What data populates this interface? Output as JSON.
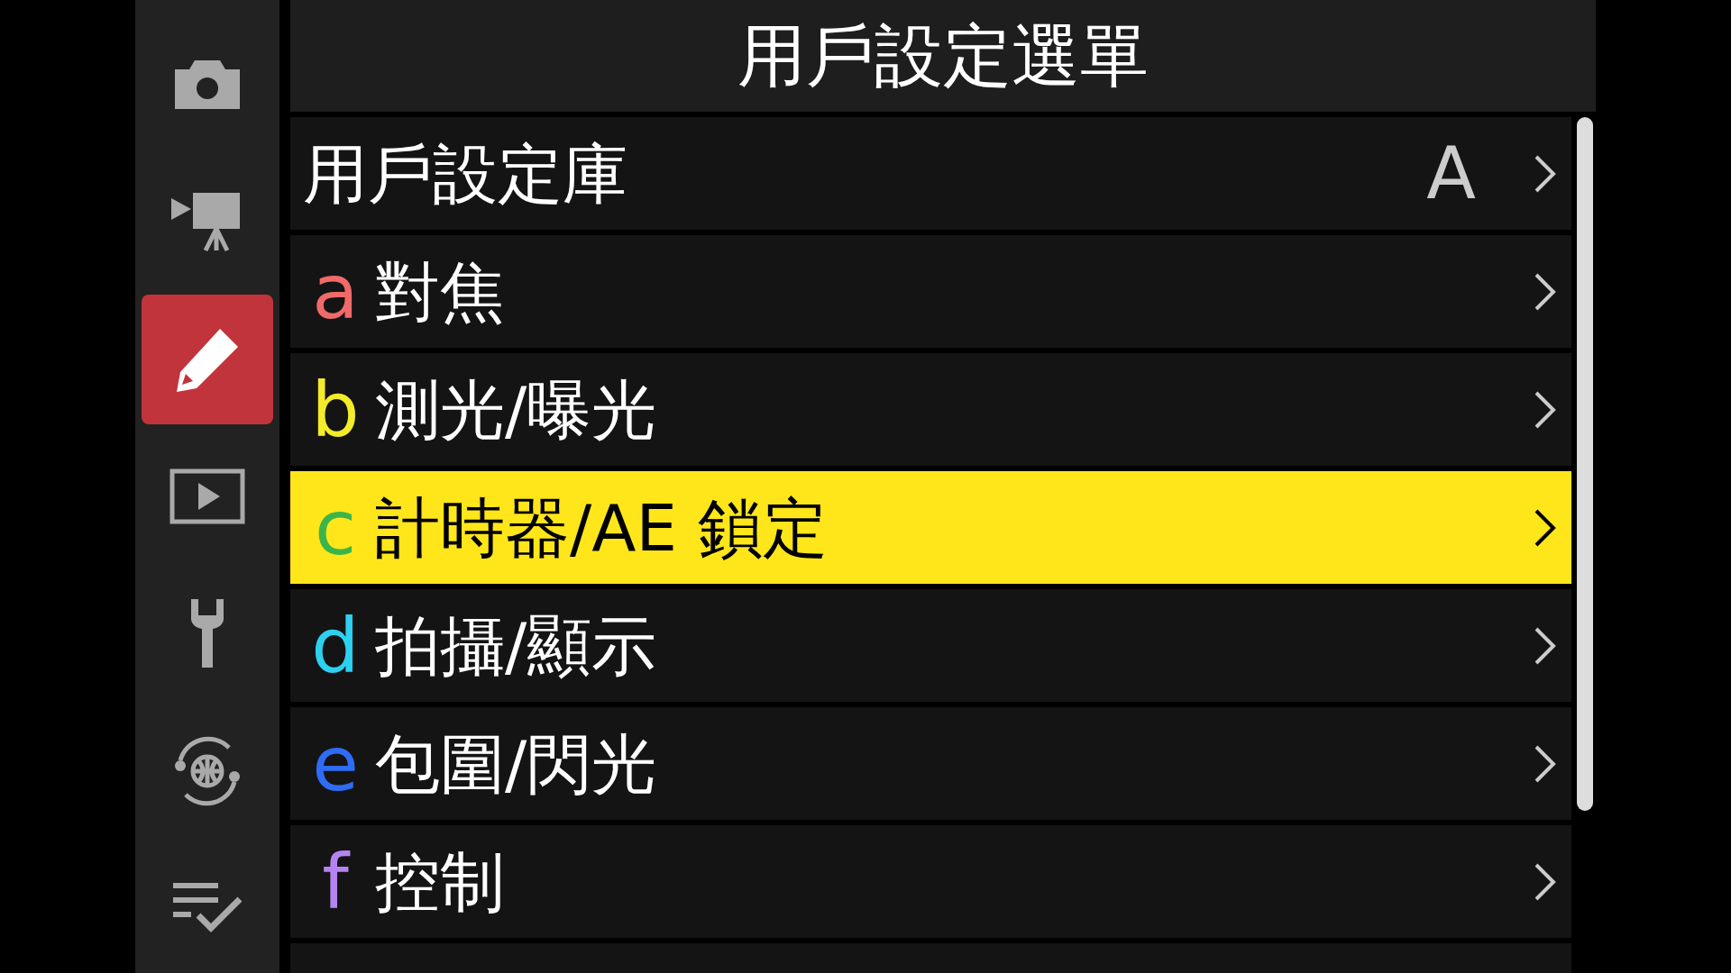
{
  "sidebar": {
    "items": [
      {
        "kind": "camera",
        "selected": false
      },
      {
        "kind": "video",
        "selected": false
      },
      {
        "kind": "pencil",
        "selected": true
      },
      {
        "kind": "playback",
        "selected": false
      },
      {
        "kind": "wrench",
        "selected": false
      },
      {
        "kind": "network",
        "selected": false
      },
      {
        "kind": "checklist",
        "selected": false
      }
    ]
  },
  "header": {
    "title": "用戶設定選單"
  },
  "menu": {
    "items": [
      {
        "label": "用戶設定庫",
        "value": "A",
        "selected": false
      },
      {
        "letter": "a",
        "color": "#f06a6a",
        "label": "對焦",
        "selected": false
      },
      {
        "letter": "b",
        "color": "#f2ec2a",
        "label": "測光/曝光",
        "selected": false
      },
      {
        "letter": "c",
        "color": "#3bb54a",
        "label": "計時器/AE 鎖定",
        "selected": true
      },
      {
        "letter": "d",
        "color": "#2ed0f0",
        "label": "拍攝/顯示",
        "selected": false
      },
      {
        "letter": "e",
        "color": "#2f6cf5",
        "label": "包圍/閃光",
        "selected": false
      },
      {
        "letter": "f",
        "color": "#b584f0",
        "label": "控制",
        "selected": false
      }
    ]
  }
}
